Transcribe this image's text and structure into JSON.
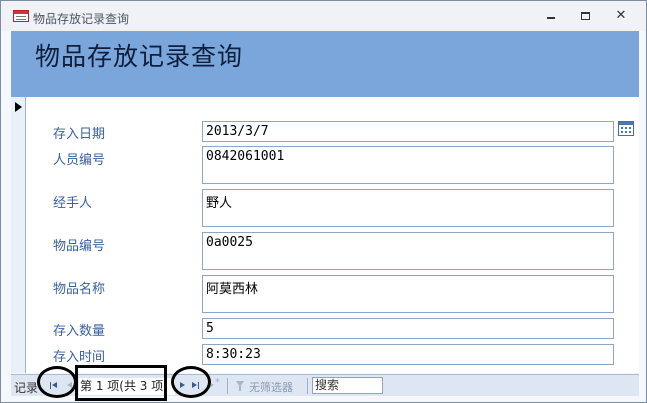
{
  "window": {
    "title": "物品存放记录查询",
    "title_icon": "form-icon"
  },
  "form": {
    "heading": "物品存放记录查询"
  },
  "fields": [
    {
      "label": "存入日期",
      "value": "2013/3/7"
    },
    {
      "label": "人员编号",
      "value": "0842061001"
    },
    {
      "label": "经手人",
      "value": "野人"
    },
    {
      "label": "物品编号",
      "value": "0a0025"
    },
    {
      "label": "物品名称",
      "value": "阿莫西林"
    },
    {
      "label": "存入数量",
      "value": "5"
    },
    {
      "label": "存入时间",
      "value": "8:30:23"
    }
  ],
  "navigation": {
    "label": "记录",
    "record_counter": "第 1 项(共 3 项",
    "filter_label": "无筛选器",
    "search_text": "搜索"
  },
  "colors": {
    "header_band": "#7ba6dc",
    "label_text": "#3a5f9c",
    "navbar": "#dde6f2"
  }
}
